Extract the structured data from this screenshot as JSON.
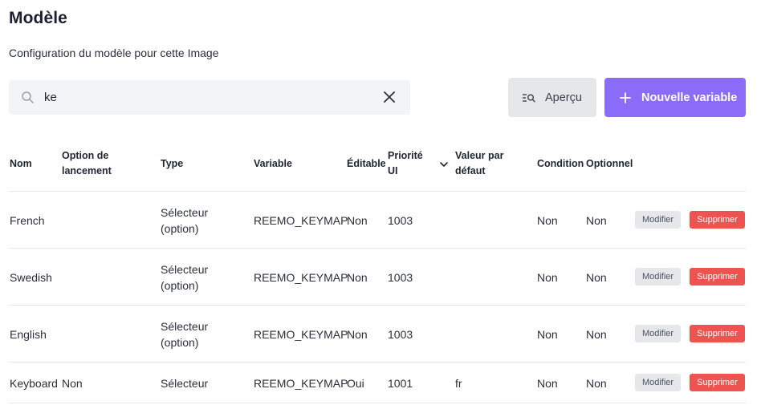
{
  "page": {
    "title": "Modèle",
    "subtitle": "Configuration du modèle pour cette Image"
  },
  "search": {
    "value": "ke",
    "icon": "search-icon",
    "clear_icon": "close-icon"
  },
  "actions": {
    "preview_label": "Aperçu",
    "preview_icon": "preview-list-icon",
    "new_variable_label": "Nouvelle variable",
    "new_variable_icon": "plus-icon"
  },
  "colors": {
    "primary": "#8b6cf8",
    "danger": "#ef5350",
    "secondary_bg": "#e6e7eb"
  },
  "table": {
    "headers": {
      "nom": "Nom",
      "option": "Option de lancement",
      "type": "Type",
      "variable": "Variable",
      "editable": "Éditable",
      "priorite": "Priorité UI",
      "valeur": "Valeur par défaut",
      "condition": "Condition",
      "optionnel": "Optionnel"
    },
    "sort_icon": "chevron-down-icon",
    "rows": [
      {
        "nom": "French",
        "option": "",
        "type": "Sélecteur (option)",
        "variable": "REEMO_KEYMAP",
        "editable": "Non",
        "priorite": "1003",
        "valeur": "",
        "condition": "Non",
        "optionnel": "Non",
        "modify": "Modifier",
        "delete": "Supprimer"
      },
      {
        "nom": "Swedish",
        "option": "",
        "type": "Sélecteur (option)",
        "variable": "REEMO_KEYMAP",
        "editable": "Non",
        "priorite": "1003",
        "valeur": "",
        "condition": "Non",
        "optionnel": "Non",
        "modify": "Modifier",
        "delete": "Supprimer"
      },
      {
        "nom": "English",
        "option": "",
        "type": "Sélecteur (option)",
        "variable": "REEMO_KEYMAP",
        "editable": "Non",
        "priorite": "1003",
        "valeur": "",
        "condition": "Non",
        "optionnel": "Non",
        "modify": "Modifier",
        "delete": "Supprimer"
      },
      {
        "nom": "Keyboard",
        "option": "Non",
        "type": "Sélecteur",
        "variable": "REEMO_KEYMAP",
        "editable": "Oui",
        "priorite": "1001",
        "valeur": "fr",
        "condition": "Non",
        "optionnel": "Non",
        "modify": "Modifier",
        "delete": "Supprimer"
      }
    ]
  }
}
